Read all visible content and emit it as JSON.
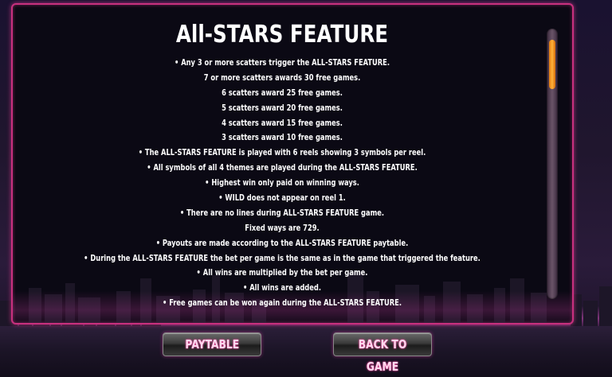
{
  "title": "All-STARS FEATURE",
  "rules": [
    "• Any 3 or more scatters trigger the ALL-STARS FEATURE.",
    "7 or more scatters awards 30 free games.",
    "6 scatters award 25 free games.",
    "5 scatters award 20 free games.",
    "4 scatters award 15 free games.",
    "3 scatters award 10 free games.",
    "• The ALL-STARS FEATURE is played with 6 reels showing 3 symbols per reel.",
    "• All symbols of all 4 themes are played during the ALL-STARS FEATURE.",
    "• Highest win only paid on winning ways.",
    "• WILD does not appear on reel 1.",
    "• There are no lines during ALL-STARS FEATURE game.",
    "Fixed ways are 729.",
    "• Payouts are made according to the ALL-STARS FEATURE paytable.",
    "• During the ALL-STARS FEATURE the bet per game is the same as in the game that triggered the feature.",
    "• All wins are multiplied by the bet per game.",
    "• All wins are added.",
    "• Free games can be won again during the ALL-STARS FEATURE."
  ],
  "buttons": {
    "paytable": "PAYTABLE",
    "back_to_game": "BACK TO GAME"
  },
  "scrollbar": {
    "position": 0
  },
  "colors": {
    "frame": "#c8307e",
    "scroll_thumb": "#ffb23a",
    "text": "#ffffff"
  }
}
